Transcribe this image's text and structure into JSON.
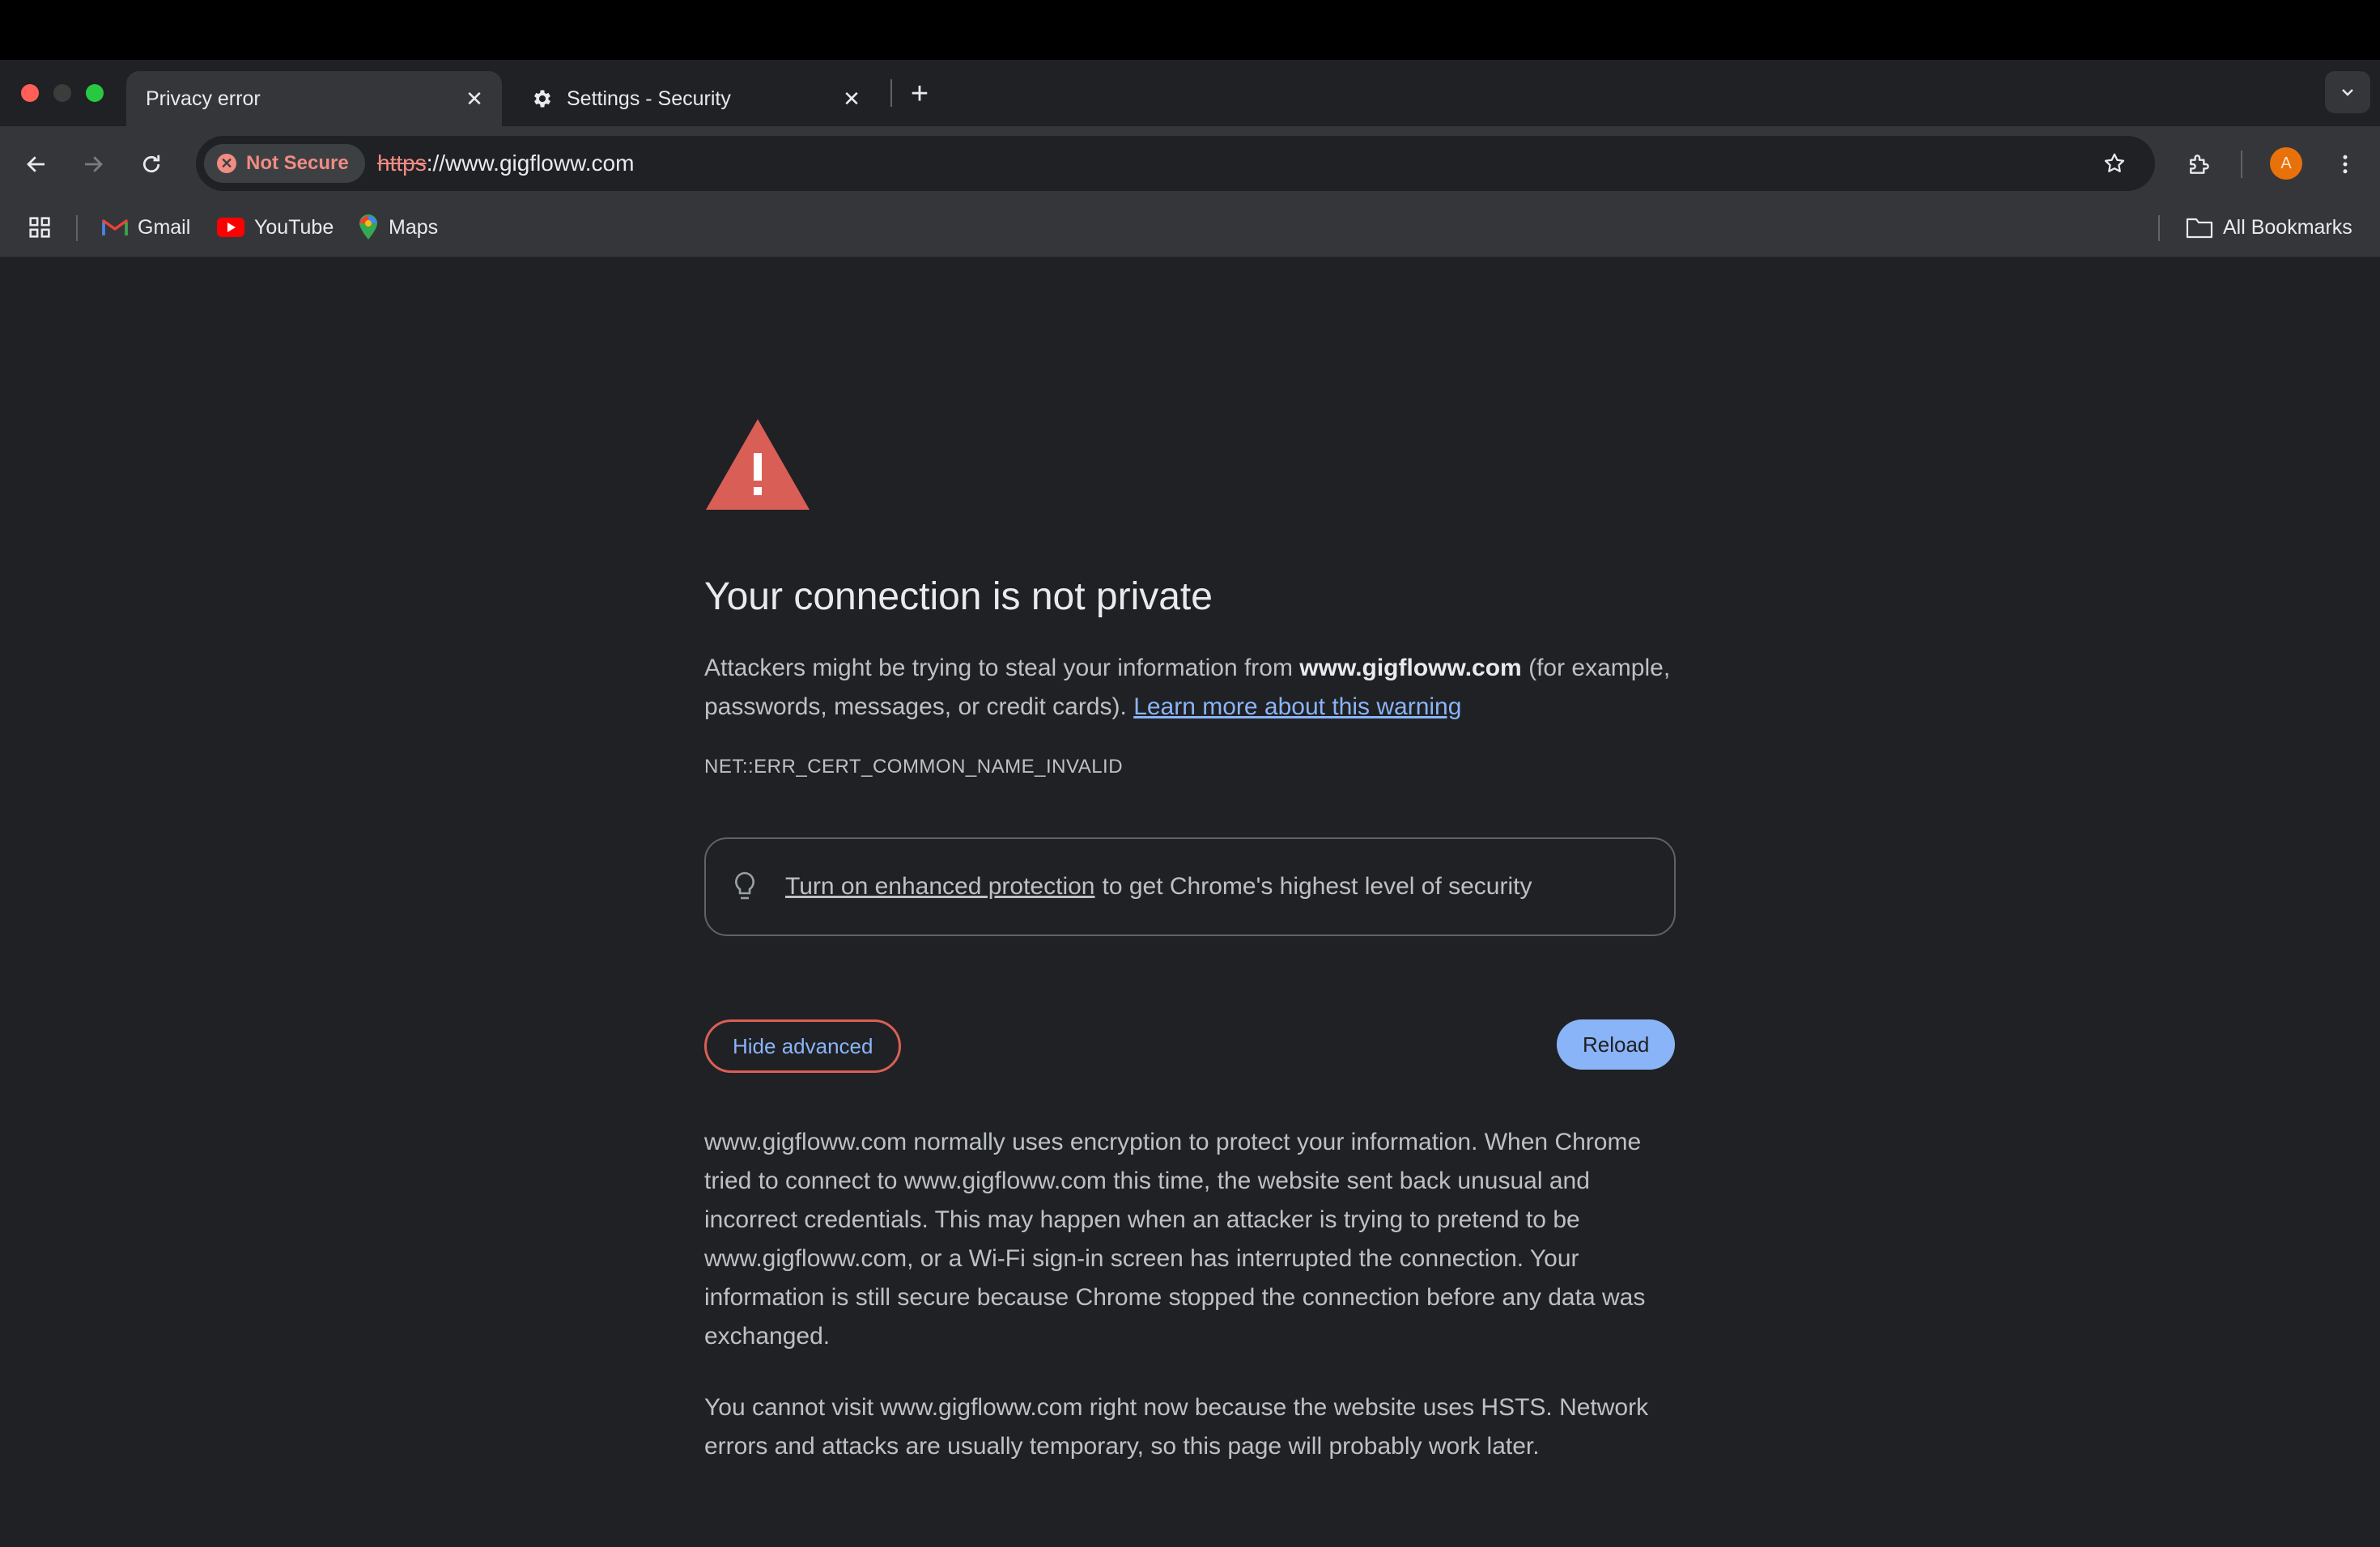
{
  "window": {
    "traffic_lights": {
      "close": "#ff5f57",
      "minimize": "#3c3c3c",
      "maximize": "#28c840"
    }
  },
  "tabs": [
    {
      "title": "Privacy error",
      "active": true,
      "close_label": "✕"
    },
    {
      "title": "Settings - Security",
      "active": false,
      "icon": "gear-icon",
      "close_label": "✕"
    }
  ],
  "new_tab_label": "+",
  "toolbar": {
    "security_chip": "Not Secure",
    "url_scheme": "https",
    "url_rest": "://www.gigfloww.com",
    "profile_initial": "A"
  },
  "bookmarks": {
    "items": [
      {
        "label": "Gmail",
        "icon": "gmail-icon"
      },
      {
        "label": "YouTube",
        "icon": "youtube-icon"
      },
      {
        "label": "Maps",
        "icon": "maps-icon"
      }
    ],
    "all_bookmarks": "All Bookmarks"
  },
  "page": {
    "heading": "Your connection is not private",
    "intro_before": "Attackers might be trying to steal your information from ",
    "intro_domain": "www.gigfloww.com",
    "intro_after": " (for example, passwords, messages, or credit cards). ",
    "learn_more": "Learn more about this warning",
    "error_code": "NET::ERR_CERT_COMMON_NAME_INVALID",
    "enhanced_link": "Turn on enhanced protection",
    "enhanced_rest": "to get Chrome's highest level of security",
    "hide_advanced": "Hide advanced",
    "reload": "Reload",
    "details_1": "www.gigfloww.com normally uses encryption to protect your information. When Chrome tried to connect to www.gigfloww.com this time, the website sent back unusual and incorrect credentials. This may happen when an attacker is trying to pretend to be www.gigfloww.com, or a Wi-Fi sign-in screen has interrupted the connection. Your information is still secure because Chrome stopped the connection before any data was exchanged.",
    "details_2": "You cannot visit www.gigfloww.com right now because the website uses HSTS. Network errors and attacks are usually temporary, so this page will probably work later."
  },
  "colors": {
    "background": "#202124",
    "toolbar": "#35363a",
    "warning_red": "#d95f56",
    "link_blue": "#8ab4f8"
  }
}
